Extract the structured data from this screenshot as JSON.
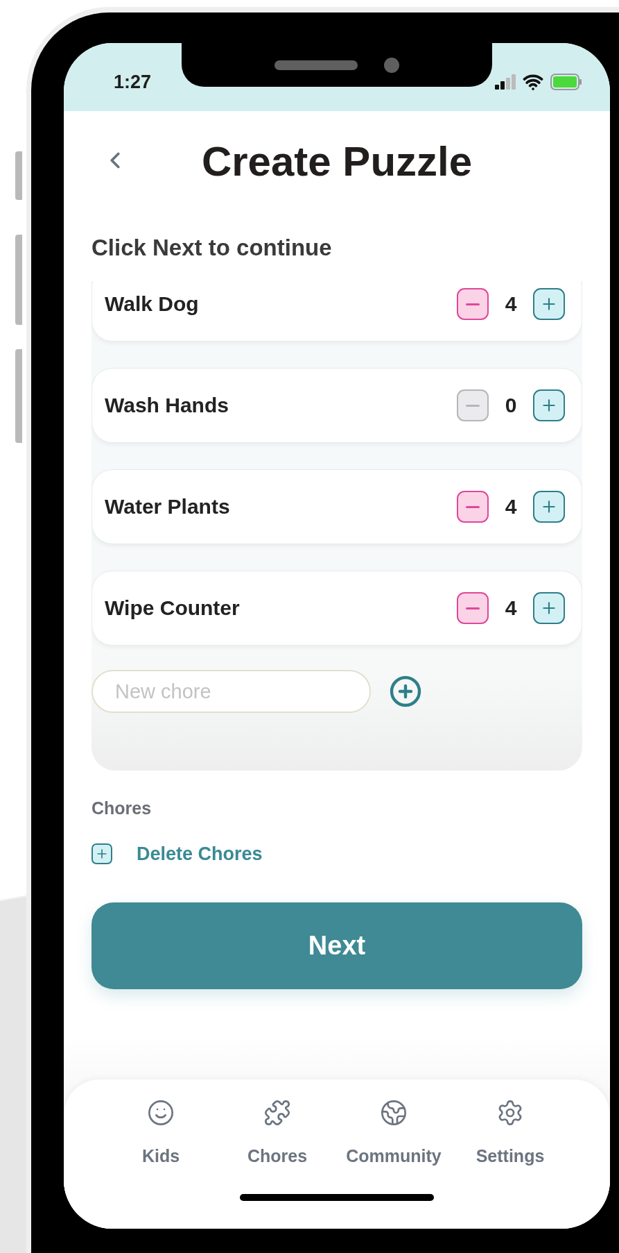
{
  "status_bar": {
    "time": "1:27"
  },
  "header": {
    "title": "Create Puzzle"
  },
  "instruction": "Click Next to continue",
  "chores": [
    {
      "name": "Walk Dog",
      "count": "4",
      "minus_disabled": false
    },
    {
      "name": "Wash Hands",
      "count": "0",
      "minus_disabled": true
    },
    {
      "name": "Water Plants",
      "count": "4",
      "minus_disabled": false
    },
    {
      "name": "Wipe Counter",
      "count": "4",
      "minus_disabled": false
    }
  ],
  "new_chore": {
    "placeholder": "New chore"
  },
  "section_label": "Chores",
  "delete_link": "Delete Chores",
  "next_button": "Next",
  "nav": [
    {
      "label": "Kids",
      "kind": "face"
    },
    {
      "label": "Chores",
      "kind": "puzzle"
    },
    {
      "label": "Community",
      "kind": "globe"
    },
    {
      "label": "Settings",
      "kind": "gear"
    }
  ]
}
